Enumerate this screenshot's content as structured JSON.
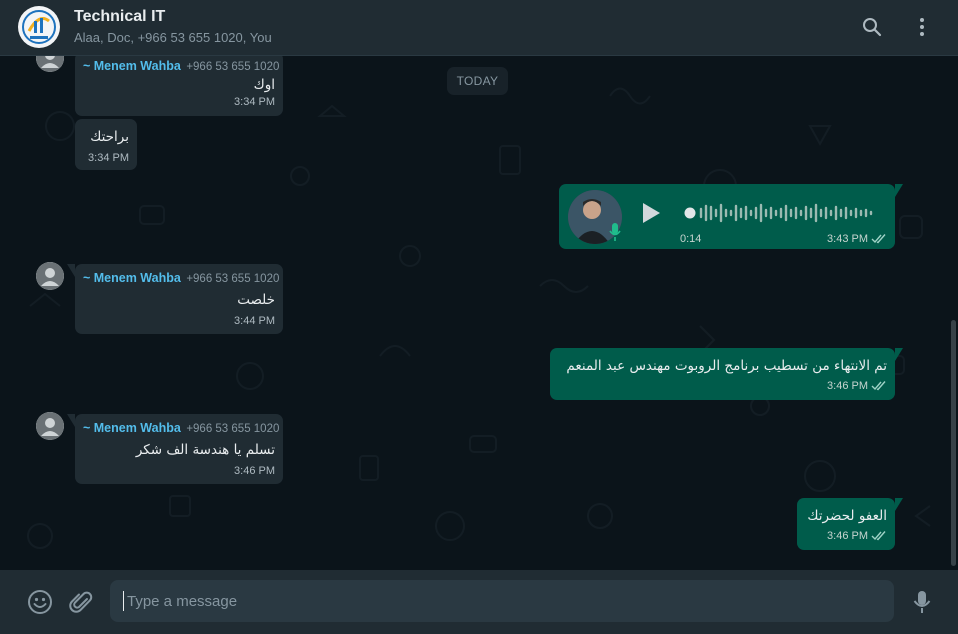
{
  "header": {
    "title": "Technical IT",
    "participants": "Alaa, Doc, +966 53 655 1020, You",
    "avatar_icon": "group-logo-icon",
    "search_icon": "search-icon",
    "menu_icon": "more-vertical-icon"
  },
  "date_divider": "TODAY",
  "messages": [
    {
      "direction": "in",
      "sender": "~ Menem Wahba",
      "phone": "+966 53 655 1020",
      "text": "اوك",
      "time": "3:34 PM"
    },
    {
      "direction": "in",
      "text": "براحتك",
      "time": "3:34 PM"
    },
    {
      "direction": "out",
      "type": "voice",
      "duration": "0:14",
      "time": "3:43 PM",
      "status": "read"
    },
    {
      "direction": "in",
      "sender": "~ Menem Wahba",
      "phone": "+966 53 655 1020",
      "text": "خلصت",
      "time": "3:44 PM"
    },
    {
      "direction": "out",
      "text": "تم الانتهاء من تسطيب برنامج الروبوت مهندس عبد المنعم",
      "time": "3:46 PM",
      "status": "read"
    },
    {
      "direction": "in",
      "sender": "~ Menem Wahba",
      "phone": "+966 53 655 1020",
      "text": "تسلم يا هندسة الف شكر",
      "time": "3:46 PM"
    },
    {
      "direction": "out",
      "text": "العفو لحضرتك",
      "time": "3:46 PM",
      "status": "read"
    }
  ],
  "composer": {
    "placeholder": "Type a message",
    "emoji_icon": "emoji-icon",
    "attach_icon": "paperclip-icon",
    "mic_icon": "microphone-icon"
  },
  "colors": {
    "header_bg": "#202c33",
    "chat_bg": "#0b141a",
    "incoming_bubble": "#202c33",
    "outgoing_bubble": "#005c4b",
    "sender_name": "#53bdeb",
    "read_ticks": "#9fd3c7"
  }
}
